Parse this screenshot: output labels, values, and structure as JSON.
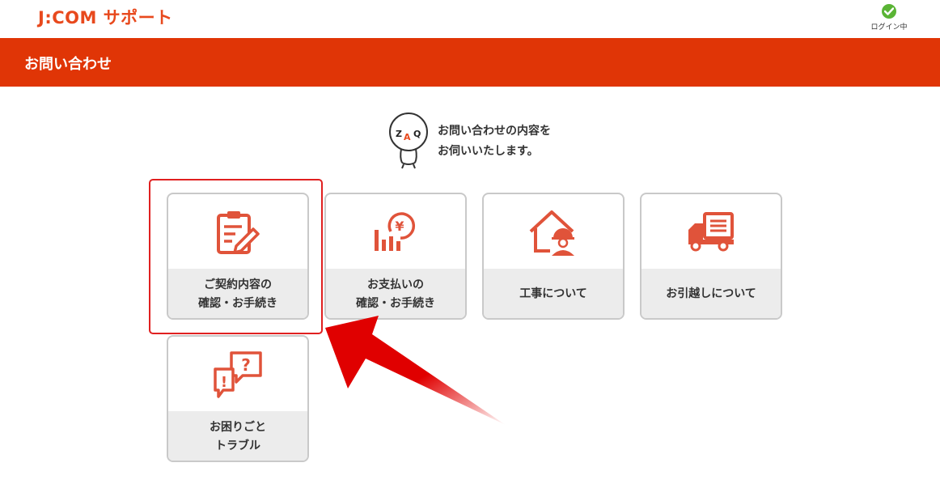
{
  "header": {
    "logo": "J:COM サポート",
    "login_status": "ログイン中"
  },
  "titlebar": {
    "title": "お問い合わせ"
  },
  "greeting": {
    "mascot_text": "ZAQ",
    "line1": "お問い合わせの内容を",
    "line2": "お伺いいたします。"
  },
  "cards": [
    {
      "label": "ご契約内容の\n確認・お手続き",
      "icon": "clipboard-edit-icon"
    },
    {
      "label": "お支払いの\n確認・お手続き",
      "icon": "yen-chart-icon"
    },
    {
      "label": "工事について",
      "icon": "house-worker-icon"
    },
    {
      "label": "お引越しについて",
      "icon": "moving-truck-icon"
    },
    {
      "label": "お困りごと\nトラブル",
      "icon": "speech-question-icon"
    }
  ],
  "colors": {
    "brand": "#e03506",
    "icon": "#e0533a",
    "highlight": "#e02020",
    "login_ok": "#5ab435"
  }
}
